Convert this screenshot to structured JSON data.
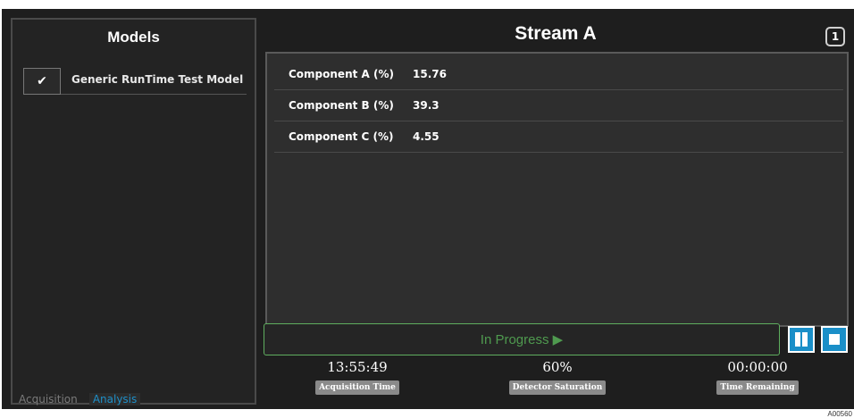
{
  "models": {
    "title": "Models",
    "items": [
      {
        "checked_glyph": "✔",
        "name": "Generic RunTime Test Model"
      }
    ]
  },
  "tabs": {
    "acquisition": "Acquisition",
    "analysis": "Analysis"
  },
  "stream": {
    "title": "Stream A",
    "number": "1"
  },
  "results": [
    {
      "label": "Component A (%)",
      "value": "15.76"
    },
    {
      "label": "Component B (%)",
      "value": "39.3"
    },
    {
      "label": "Component C (%)",
      "value": "4.55"
    }
  ],
  "progress": {
    "text": "In Progress",
    "icon": "play-icon"
  },
  "controls": {
    "pause_icon": "pause-icon",
    "stop_icon": "stop-icon"
  },
  "stats": {
    "acquisition_time": {
      "value": "13:55:49",
      "label": "Acquisition Time"
    },
    "detector_saturation": {
      "value": "60%",
      "label": "Detector Saturation"
    },
    "time_remaining": {
      "value": "00:00:00",
      "label": "Time Remaining"
    }
  },
  "figure_id": "A00560",
  "colors": {
    "background": "#1e1e1e",
    "accent_blue": "#1a8fc8",
    "progress_green": "#4f9a4f"
  }
}
